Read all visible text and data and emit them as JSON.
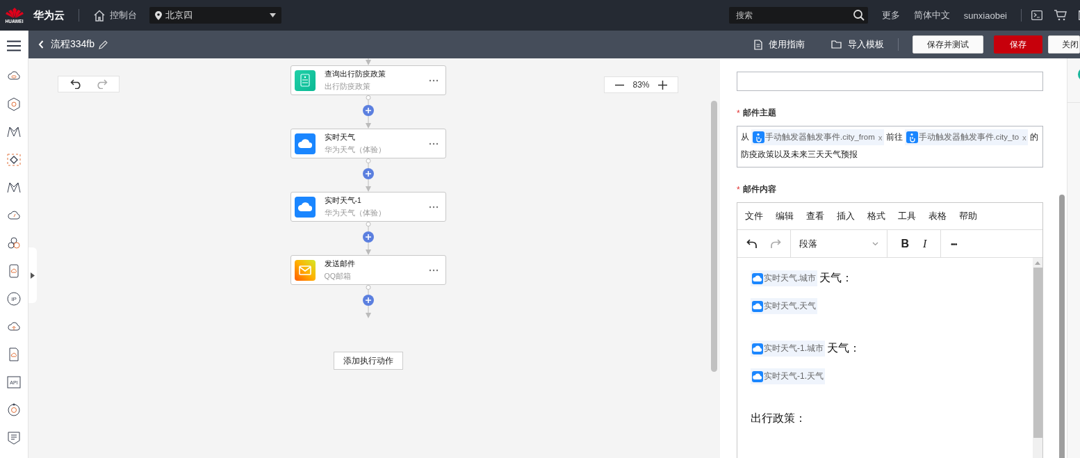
{
  "topbar": {
    "logo_text": "HUAWEI",
    "brand": "华为云",
    "console": "控制台",
    "region": "北京四",
    "search": {
      "placeholder": "搜索"
    },
    "links": [
      "更多",
      "简体中文",
      "sunxiaobei"
    ]
  },
  "sidebar": {
    "items": [
      {
        "kind": "cloud"
      },
      {
        "kind": "hexagon"
      },
      {
        "kind": "zigzag"
      },
      {
        "kind": "diamond"
      },
      {
        "kind": "zigzag"
      },
      {
        "kind": "gauge"
      },
      {
        "kind": "circles"
      },
      {
        "kind": "tablet"
      },
      {
        "kind": "ip",
        "text": "IP"
      },
      {
        "kind": "upload"
      },
      {
        "kind": "document"
      },
      {
        "kind": "api",
        "text": "API"
      },
      {
        "kind": "target"
      },
      {
        "kind": "list"
      }
    ]
  },
  "header": {
    "title": "流程334fb",
    "actions": [
      {
        "label": "使用指南",
        "kind": "doc"
      },
      {
        "label": "导入模板",
        "kind": "folder"
      }
    ],
    "buttons": [
      {
        "label": "保存并测试",
        "kind": "default"
      },
      {
        "label": "保存",
        "kind": "primary"
      },
      {
        "label": "关闭",
        "kind": "default"
      }
    ]
  },
  "canvas": {
    "zoom": "83%",
    "nodes": [
      {
        "title": "查询出行防疫政策",
        "subtitle": "出行防疫政策",
        "kind": "policy"
      },
      {
        "title": "实时天气",
        "subtitle": "华为天气（体验）",
        "kind": "weather"
      },
      {
        "title": "实时天气-1",
        "subtitle": "华为天气（体验）",
        "kind": "weather"
      },
      {
        "title": "发送邮件",
        "subtitle": "QQ邮箱",
        "kind": "mail"
      }
    ],
    "add_action": "添加执行动作"
  },
  "form": {
    "required_mark": "*",
    "subject": {
      "label": "邮件主题",
      "parts": [
        {
          "kind": "text",
          "text": "从"
        },
        {
          "kind": "token",
          "text": "手动触发器触发事件.city_from",
          "remove": "x"
        },
        {
          "kind": "text",
          "text": "前往"
        },
        {
          "kind": "token",
          "text": "手动触发器触发事件.city_to",
          "remove": "x"
        },
        {
          "kind": "text",
          "text": "的"
        },
        {
          "kind": "text",
          "text": "防疫政策以及未来三天天气预报"
        }
      ]
    },
    "content": {
      "label": "邮件内容",
      "menus": [
        "文件",
        "编辑",
        "查看",
        "插入",
        "格式",
        "工具",
        "表格",
        "帮助"
      ],
      "format": "段落",
      "bold": "B",
      "italic": "I",
      "more": "•••",
      "sections": [
        {
          "lines": [
            [
              {
                "kind": "token",
                "text": "实时天气.城市"
              },
              {
                "kind": "text",
                "text": "天气："
              }
            ],
            [
              {
                "kind": "token",
                "text": "实时天气.天气"
              }
            ]
          ]
        },
        {
          "lines": [
            [
              {
                "kind": "token",
                "text": "实时天气-1.城市"
              },
              {
                "kind": "text",
                "text": "天气："
              }
            ],
            [
              {
                "kind": "token",
                "text": "实时天气-1.天气"
              }
            ]
          ]
        },
        {
          "lines": [
            [
              {
                "kind": "text",
                "text": "出行政策："
              }
            ]
          ]
        }
      ]
    }
  }
}
